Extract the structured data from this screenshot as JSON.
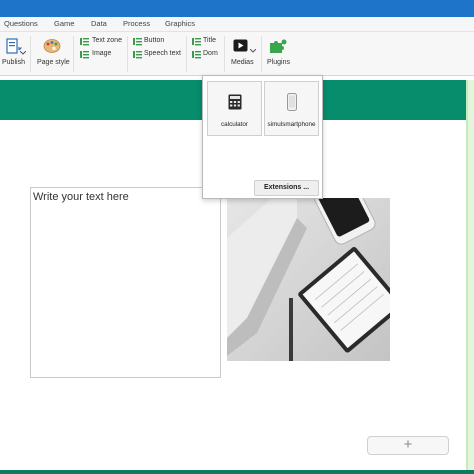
{
  "menu": {
    "items": [
      "Questions",
      "Game",
      "Data",
      "Process",
      "Graphics"
    ]
  },
  "ribbon": {
    "publish": "Publish",
    "page_style": "Page style",
    "text_zone": "Text zone",
    "image": "Image",
    "button": "Button",
    "speech_text": "Speech text",
    "title": "Title",
    "dom": "Dom",
    "medias": "Medias",
    "plugins": "Plugins"
  },
  "medias_menu": {
    "items": [
      {
        "label": "calculator",
        "icon": "calculator-icon"
      },
      {
        "label": "simulsmartphone",
        "icon": "smartphone-icon"
      }
    ],
    "extensions_button": "Extensions ..."
  },
  "canvas": {
    "text_zone_content": "Write your text here",
    "add_button": "+"
  },
  "colors": {
    "title_bar": "#1e74c8",
    "header_band": "#078c6c",
    "plugins_icon": "#3aa54a",
    "ribbon_icon_green": "#3a9c48"
  }
}
